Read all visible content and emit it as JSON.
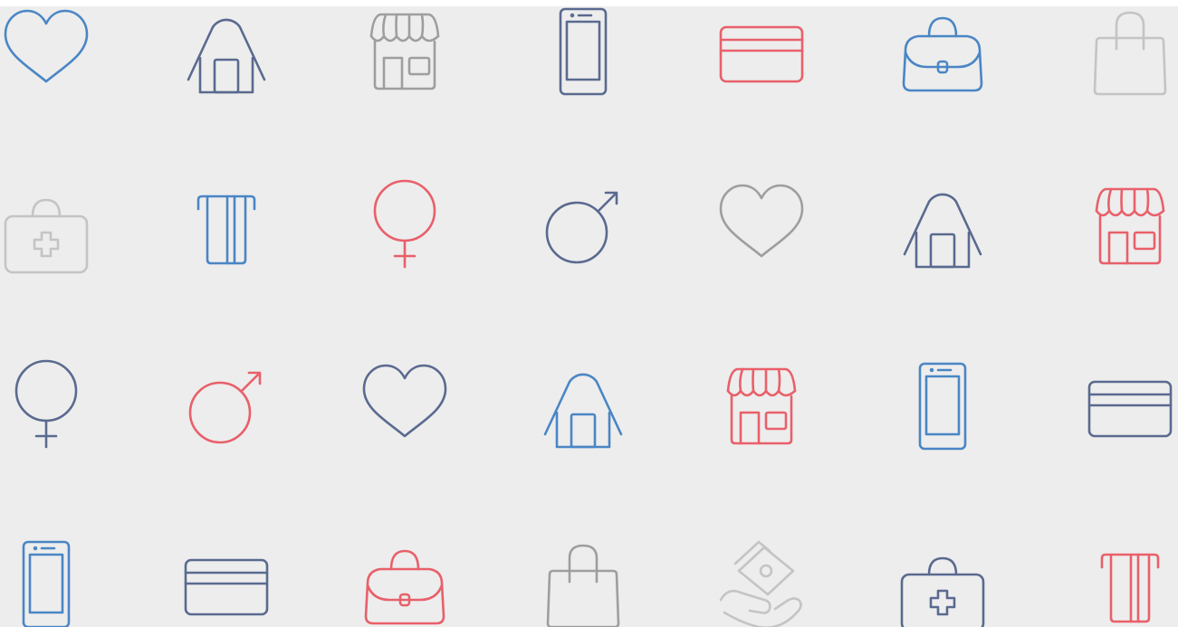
{
  "palette": {
    "blue": "#4a86c5",
    "navy": "#5a6a8f",
    "gray": "#9e9e9e",
    "lightgray": "#c4c4c4",
    "red": "#e8606a"
  },
  "rows": [
    [
      {
        "name": "heart-icon",
        "icon": "heart",
        "color": "blue"
      },
      {
        "name": "house-icon",
        "icon": "house",
        "color": "navy"
      },
      {
        "name": "storefront-icon",
        "icon": "shop",
        "color": "gray"
      },
      {
        "name": "smartphone-icon",
        "icon": "phone",
        "color": "navy"
      },
      {
        "name": "credit-card-icon",
        "icon": "card",
        "color": "red"
      },
      {
        "name": "handbag-icon",
        "icon": "handbag",
        "color": "blue"
      },
      {
        "name": "shopping-bag-icon",
        "icon": "shopbag",
        "color": "lightgray"
      }
    ],
    [
      {
        "name": "medical-kit-icon",
        "icon": "medkit",
        "color": "lightgray"
      },
      {
        "name": "atm-card-icon",
        "icon": "atm",
        "color": "blue"
      },
      {
        "name": "female-symbol-icon",
        "icon": "female",
        "color": "red"
      },
      {
        "name": "male-symbol-icon",
        "icon": "male",
        "color": "navy"
      },
      {
        "name": "heart-icon",
        "icon": "heart",
        "color": "gray"
      },
      {
        "name": "house-icon",
        "icon": "house",
        "color": "navy"
      },
      {
        "name": "storefront-icon",
        "icon": "shop",
        "color": "red"
      }
    ],
    [
      {
        "name": "female-symbol-icon",
        "icon": "female",
        "color": "navy"
      },
      {
        "name": "male-symbol-icon",
        "icon": "male",
        "color": "red"
      },
      {
        "name": "heart-icon",
        "icon": "heart",
        "color": "navy"
      },
      {
        "name": "house-icon",
        "icon": "house",
        "color": "blue"
      },
      {
        "name": "storefront-icon",
        "icon": "shop",
        "color": "red"
      },
      {
        "name": "smartphone-icon",
        "icon": "phone",
        "color": "blue"
      },
      {
        "name": "credit-card-icon",
        "icon": "card",
        "color": "navy"
      }
    ],
    [
      {
        "name": "smartphone-icon",
        "icon": "phone",
        "color": "blue"
      },
      {
        "name": "credit-card-icon",
        "icon": "card",
        "color": "navy"
      },
      {
        "name": "handbag-icon",
        "icon": "handbag",
        "color": "red"
      },
      {
        "name": "shopping-bag-icon",
        "icon": "shopbag",
        "color": "gray"
      },
      {
        "name": "cash-in-hand-icon",
        "icon": "cashhand",
        "color": "lightgray"
      },
      {
        "name": "medical-kit-icon",
        "icon": "medkit",
        "color": "navy"
      },
      {
        "name": "atm-card-icon",
        "icon": "atm",
        "color": "red"
      }
    ]
  ]
}
